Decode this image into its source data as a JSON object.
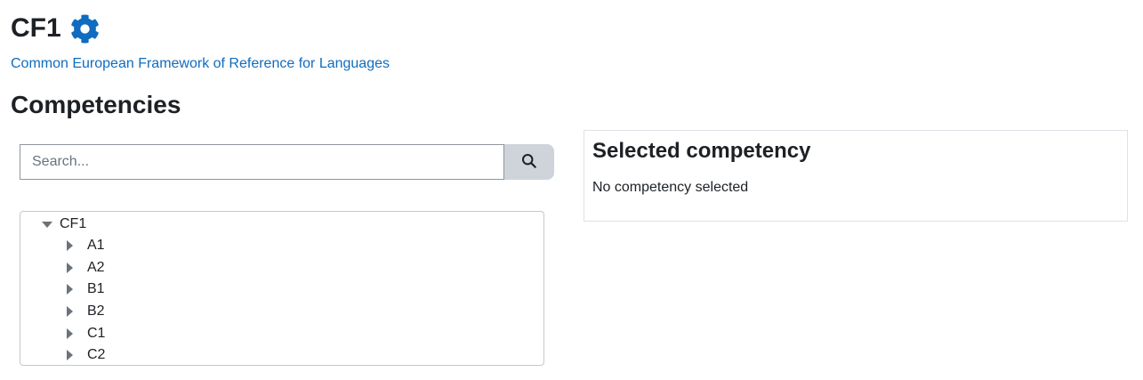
{
  "header": {
    "title": "CF1",
    "settings_icon": "gear-icon",
    "framework_link": "Common European Framework of Reference for Languages"
  },
  "competencies": {
    "heading": "Competencies",
    "search": {
      "placeholder": "Search...",
      "value": "",
      "button_icon": "search-icon"
    },
    "tree": {
      "root": "CF1",
      "items": [
        {
          "label": "A1"
        },
        {
          "label": "A2"
        },
        {
          "label": "B1"
        },
        {
          "label": "B2"
        },
        {
          "label": "C1"
        },
        {
          "label": "C2"
        }
      ]
    }
  },
  "selected": {
    "heading": "Selected competency",
    "text": "No competency selected"
  },
  "colors": {
    "link": "#0f6cbf",
    "text": "#1d2125",
    "search_button_bg": "#ced4da",
    "caret": "#6a737b"
  }
}
